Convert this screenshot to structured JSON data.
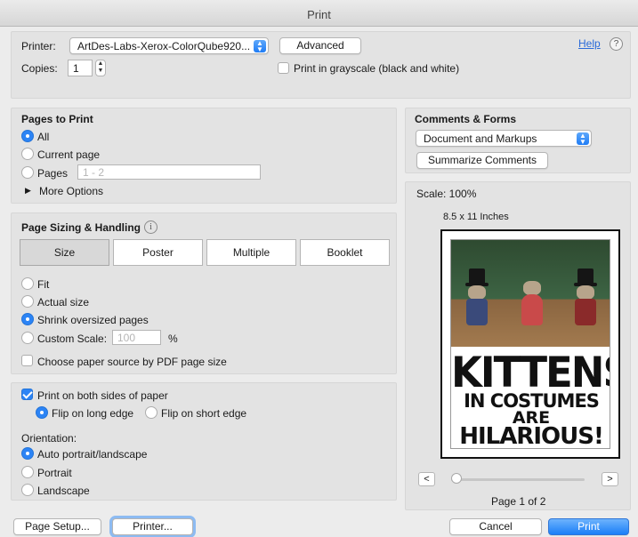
{
  "window": {
    "title": "Print"
  },
  "printer": {
    "label": "Printer:",
    "value": "ArtDes-Labs-Xerox-ColorQube920...",
    "advanced_label": "Advanced",
    "help_label": "Help"
  },
  "copies": {
    "label": "Copies:",
    "value": "1"
  },
  "grayscale": {
    "label": "Print in grayscale (black and white)",
    "checked": false
  },
  "pages_to_print": {
    "title": "Pages to Print",
    "options": [
      {
        "label": "All",
        "selected": true
      },
      {
        "label": "Current page",
        "selected": false
      },
      {
        "label": "Pages",
        "selected": false
      }
    ],
    "pages_placeholder": "1 - 2",
    "more_options_label": "More Options"
  },
  "comments_forms": {
    "title": "Comments & Forms",
    "value": "Document and Markups",
    "summarize_label": "Summarize Comments"
  },
  "sizing": {
    "title": "Page Sizing & Handling",
    "tabs": [
      {
        "label": "Size",
        "selected": true
      },
      {
        "label": "Poster",
        "selected": false
      },
      {
        "label": "Multiple",
        "selected": false
      },
      {
        "label": "Booklet",
        "selected": false
      }
    ],
    "options": [
      {
        "label": "Fit",
        "selected": false
      },
      {
        "label": "Actual size",
        "selected": false
      },
      {
        "label": "Shrink oversized pages",
        "selected": true
      },
      {
        "label": "Custom Scale:",
        "selected": false
      }
    ],
    "custom_scale_placeholder": "100",
    "percent": "%",
    "paper_source_label": "Choose paper source by PDF page size"
  },
  "duplex": {
    "label": "Print on both sides of paper",
    "checked": true,
    "flip_long": "Flip on long edge",
    "flip_short": "Flip on short edge"
  },
  "orientation": {
    "title": "Orientation:",
    "options": [
      {
        "label": "Auto portrait/landscape",
        "selected": true
      },
      {
        "label": "Portrait",
        "selected": false
      },
      {
        "label": "Landscape",
        "selected": false
      }
    ]
  },
  "preview": {
    "scale": "Scale: 100%",
    "paper_size": "8.5 x 11 Inches",
    "poster_lines": [
      "KITTENS",
      "IN COSTUMES",
      "ARE",
      "HILARIOUS!"
    ],
    "prev_label": "<",
    "next_label": ">",
    "page_indicator": "Page 1 of 2"
  },
  "footer": {
    "page_setup": "Page Setup...",
    "printer": "Printer...",
    "cancel": "Cancel",
    "print": "Print"
  },
  "colors": {
    "accent": "#2c84f5",
    "panel": "#e3e3e3",
    "window": "#ececec"
  }
}
